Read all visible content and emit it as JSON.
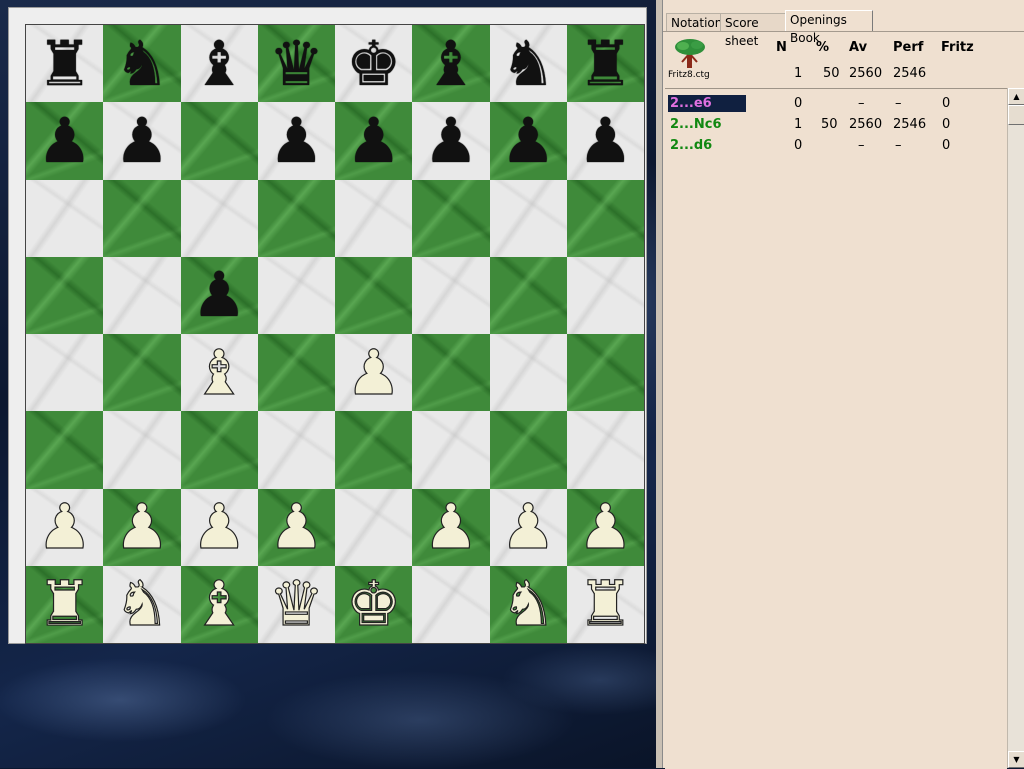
{
  "board": {
    "ranks": [
      [
        {
          "p": "♜",
          "c": "b",
          "n": "black-rook"
        },
        {
          "p": "♞",
          "c": "b",
          "n": "black-knight"
        },
        {
          "p": "♝",
          "c": "b",
          "n": "black-bishop"
        },
        {
          "p": "♛",
          "c": "b",
          "n": "black-queen"
        },
        {
          "p": "♚",
          "c": "b",
          "n": "black-king"
        },
        {
          "p": "♝",
          "c": "b",
          "n": "black-bishop"
        },
        {
          "p": "♞",
          "c": "b",
          "n": "black-knight"
        },
        {
          "p": "♜",
          "c": "b",
          "n": "black-rook"
        }
      ],
      [
        {
          "p": "♟",
          "c": "b",
          "n": "black-pawn"
        },
        {
          "p": "♟",
          "c": "b",
          "n": "black-pawn"
        },
        null,
        {
          "p": "♟",
          "c": "b",
          "n": "black-pawn"
        },
        {
          "p": "♟",
          "c": "b",
          "n": "black-pawn"
        },
        {
          "p": "♟",
          "c": "b",
          "n": "black-pawn"
        },
        {
          "p": "♟",
          "c": "b",
          "n": "black-pawn"
        },
        {
          "p": "♟",
          "c": "b",
          "n": "black-pawn"
        }
      ],
      [
        null,
        null,
        null,
        null,
        null,
        null,
        null,
        null
      ],
      [
        null,
        null,
        {
          "p": "♟",
          "c": "b",
          "n": "black-pawn"
        },
        null,
        null,
        null,
        null,
        null
      ],
      [
        null,
        null,
        {
          "p": "♝",
          "c": "w",
          "n": "white-bishop"
        },
        null,
        {
          "p": "♟",
          "c": "w",
          "n": "white-pawn"
        },
        null,
        null,
        null
      ],
      [
        null,
        null,
        null,
        null,
        null,
        null,
        null,
        null
      ],
      [
        {
          "p": "♟",
          "c": "w",
          "n": "white-pawn"
        },
        {
          "p": "♟",
          "c": "w",
          "n": "white-pawn"
        },
        {
          "p": "♟",
          "c": "w",
          "n": "white-pawn"
        },
        {
          "p": "♟",
          "c": "w",
          "n": "white-pawn"
        },
        null,
        {
          "p": "♟",
          "c": "w",
          "n": "white-pawn"
        },
        {
          "p": "♟",
          "c": "w",
          "n": "white-pawn"
        },
        {
          "p": "♟",
          "c": "w",
          "n": "white-pawn"
        }
      ],
      [
        {
          "p": "♜",
          "c": "w",
          "n": "white-rook"
        },
        {
          "p": "♞",
          "c": "w",
          "n": "white-knight"
        },
        {
          "p": "♝",
          "c": "w",
          "n": "white-bishop"
        },
        {
          "p": "♛",
          "c": "w",
          "n": "white-queen"
        },
        {
          "p": "♚",
          "c": "w",
          "n": "white-king"
        },
        null,
        {
          "p": "♞",
          "c": "w",
          "n": "white-knight"
        },
        {
          "p": "♜",
          "c": "w",
          "n": "white-rook"
        }
      ]
    ]
  },
  "tabs": [
    {
      "label": "Notation"
    },
    {
      "label": "Score sheet"
    },
    {
      "label": "Openings Book"
    }
  ],
  "book": {
    "file": "Fritz8.ctg",
    "headers": {
      "n": "N",
      "pct": "%",
      "av": "Av",
      "perf": "Perf",
      "fritz": "Fritz"
    },
    "totals": {
      "n": "1",
      "pct": "50",
      "av": "2560",
      "perf": "2546"
    },
    "moves": [
      {
        "move": "2...e6",
        "n": "0",
        "pct": "",
        "av": "–",
        "perf": "–",
        "fritz": "0"
      },
      {
        "move": "2...Nc6",
        "n": "1",
        "pct": "50",
        "av": "2560",
        "perf": "2546",
        "fritz": "0"
      },
      {
        "move": "2...d6",
        "n": "0",
        "pct": "",
        "av": "–",
        "perf": "–",
        "fritz": "0"
      }
    ]
  },
  "scrollbar": {
    "up": "▲",
    "down": "▼"
  }
}
